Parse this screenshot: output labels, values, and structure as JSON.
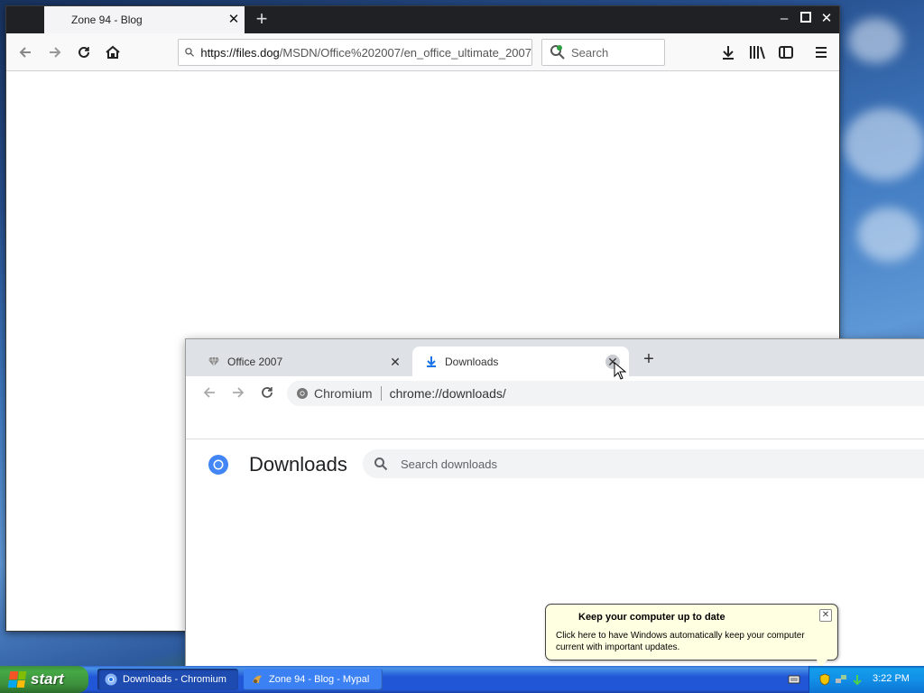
{
  "firefox": {
    "tab_title": "Zone 94 - Blog",
    "url_host": "https://files.dog",
    "url_path": "/MSDN/Office%202007/en_office_ultimate_2007",
    "search_placeholder": "Search"
  },
  "chromium": {
    "tabs": [
      {
        "label": "Office 2007"
      },
      {
        "label": "Downloads"
      }
    ],
    "site_chip": "Chromium",
    "url": "chrome://downloads/",
    "page_title": "Downloads",
    "search_placeholder": "Search downloads"
  },
  "balloon": {
    "title": "Keep your computer up to date",
    "body": "Click here to have Windows automatically keep your computer current with important updates."
  },
  "taskbar": {
    "start_label": "start",
    "tasks": [
      {
        "label": "Downloads - Chromium"
      },
      {
        "label": "Zone 94 - Blog - Mypal"
      }
    ],
    "clock": "3:22 PM"
  }
}
